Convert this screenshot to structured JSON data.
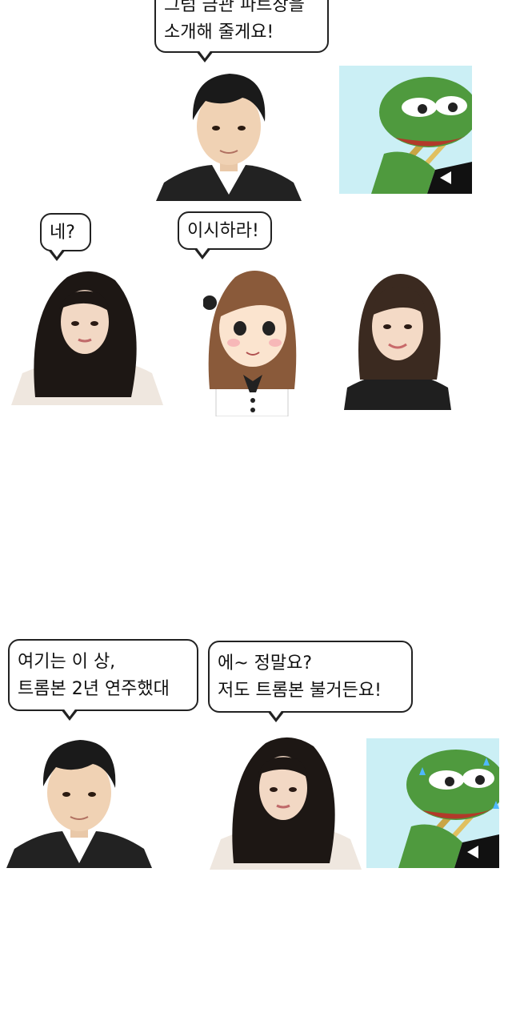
{
  "scene1": {
    "bubble_lines": [
      "그럼 금관 파트장을",
      "소개해 줄게요!"
    ],
    "man": "man-portrait",
    "frog": "pepe-frog-trombone"
  },
  "scene2": {
    "left_bubble": "네?",
    "center_bubble": "이시하라!",
    "left_woman": "woman-portrait-long-hair",
    "cartoon": "illustrated-girl",
    "right_woman": "woman-portrait-short-hair"
  },
  "scene3": {
    "left_bubble_lines": [
      "여기는 이 상,",
      "트롬본 2년 연주했대"
    ],
    "right_bubble_lines": [
      "에~ 정말요?",
      "저도 트롬본 불거든요!"
    ],
    "man": "man-portrait",
    "woman": "woman-portrait-long-hair",
    "frog": "pepe-frog-trombone-sweating"
  }
}
